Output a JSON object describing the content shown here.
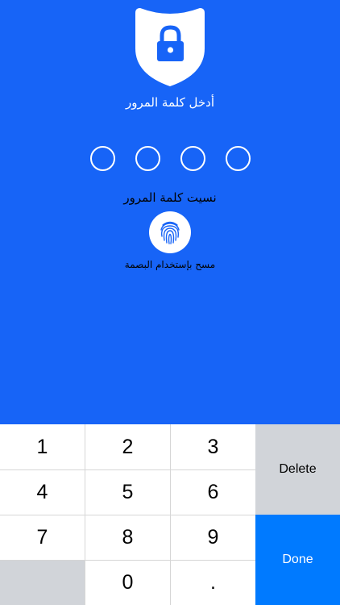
{
  "colors": {
    "background": "#1764F7",
    "keypad_background": "#FFFFFF",
    "keypad_function_key": "#D1D4D9",
    "done_key": "#007AFF"
  },
  "lock_screen": {
    "shield_icon": "shield-lock-icon",
    "prompt": "أدخل كلمة المرور",
    "pin_length": 4,
    "pin_filled": 0,
    "forgot_password": "نسيت كلمة المرور",
    "fingerprint_icon": "fingerprint-icon",
    "fingerprint_label": "مسح بإستخدام البصمة"
  },
  "keypad": {
    "keys": [
      "1",
      "2",
      "3",
      "4",
      "5",
      "6",
      "7",
      "8",
      "9",
      "",
      "0",
      "."
    ],
    "delete_label": "Delete",
    "done_label": "Done"
  }
}
